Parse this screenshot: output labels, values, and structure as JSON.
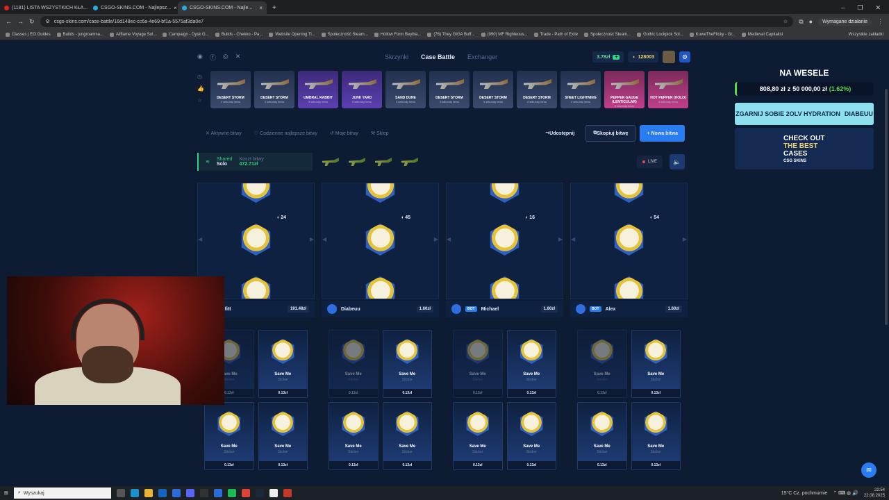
{
  "browser": {
    "tabs": [
      {
        "title": "(1181) LISTA WSZYSTKICH KŁA...",
        "color": "#e62117"
      },
      {
        "title": "CSGO-SKINS.COM - Najlepsz...",
        "color": "#27a9e1"
      },
      {
        "title": "CSGO-SKINS.COM - Najle...",
        "color": "#27a9e1"
      }
    ],
    "url": "csgo-skins.com/case-battle/16d148ec-cc6a-4e69-bf1a-5575af3da0e7",
    "action_label": "Wymagane działanie",
    "bookmarks": [
      "Classes | EO Guides",
      "Builds - jungroanma...",
      "Allflame Voyage Sol...",
      "Campaign - Dysk G...",
      "Builds - Chekko - Pa...",
      "Website Opening Ti...",
      "Społeczność Steam...",
      "Hollow Form Beybla...",
      "(76) They GIGA Buff...",
      "(990) MF Righteous...",
      "Trade - Path of Exile",
      "Społeczność Steam...",
      "Gothic Lockpick Sol...",
      "KuweTheFlicky - Gi...",
      "Medieval Capitalist"
    ],
    "bookmarks_all": "Wszystkie zakładki"
  },
  "nav": {
    "links": [
      "Skrzynki",
      "Case Battle",
      "Exchanger"
    ],
    "active": "Case Battle",
    "balance_money": "3.78zł",
    "balance_coins": "128003"
  },
  "drops": [
    {
      "name": "DESERT STORM",
      "sub": "2 sekundy temu",
      "style": ""
    },
    {
      "name": "DESERT STORM",
      "sub": "2 sekundy temu",
      "style": ""
    },
    {
      "name": "UMBRAL RABBIT",
      "sub": "3 sekundy temu",
      "style": "purple"
    },
    {
      "name": "JUNK YARD",
      "sub": "3 sekundy temu",
      "style": "purple"
    },
    {
      "name": "SAND DUNE",
      "sub": "3 sekundy temu",
      "style": ""
    },
    {
      "name": "DESERT STORM",
      "sub": "3 sekundy temu",
      "style": ""
    },
    {
      "name": "DESERT STORM",
      "sub": "3 sekundy temu",
      "style": ""
    },
    {
      "name": "DESERT STORM",
      "sub": "4 sekundy temu",
      "style": ""
    },
    {
      "name": "SHEET LIGHTNING",
      "sub": "4 sekundy temu",
      "style": ""
    },
    {
      "name": "PEPPER GAUGE (LENTICULAR)",
      "sub": "4 sekundy temu",
      "style": "pink"
    },
    {
      "name": "HOT PEPPER (HOLO)",
      "sub": "4 sekundy temu",
      "style": "pink"
    }
  ],
  "controls": {
    "active_battles": "Aktywne bitwy",
    "daily_best": "Codzienne najlepsze bitwy",
    "my_battles": "Moje bitwy",
    "shop": "Sklep",
    "share": "Udostępnij",
    "copy": "Skopiuj bitwę",
    "new": "+ Nowa bitwa"
  },
  "battle": {
    "mode_label": "Shared",
    "mode_value": "Solo",
    "cost_label": "Koszt bitwy",
    "cost_value": "472.71zł",
    "live": "LIVE"
  },
  "reels": [
    {
      "coins": "24"
    },
    {
      "coins": "45"
    },
    {
      "coins": "16"
    },
    {
      "coins": "54"
    }
  ],
  "players": [
    {
      "name": "via fitt",
      "price": "191.48zł",
      "bot": false
    },
    {
      "name": "Diabeuu",
      "price": "1.60zł",
      "bot": false
    },
    {
      "name": "Michael",
      "price": "1.60zł",
      "bot": true
    },
    {
      "name": "Alex",
      "price": "1.60zł",
      "bot": true
    }
  ],
  "item": {
    "name": "Save Me",
    "type": "Sticker",
    "price": "0.13zł"
  },
  "bot_label": "BOT",
  "promo": {
    "title": "NA WESELE",
    "amount": "808,80 zł",
    "of": "z",
    "goal": "50 000,00 zł",
    "percent": "(1.62%)",
    "ad1": "ZGARNIJ SOBIE 2OLV HYDRATION",
    "ad1_tag": "DIABEUU",
    "ad2_a": "CHECK OUT",
    "ad2_b": "THE BEST",
    "ad2_c": "CASES",
    "ad2_brand": "CSG SKINS"
  },
  "taskbar": {
    "search": "Wyszukaj",
    "weather": "15°C  Cz. pochmurnie",
    "time": "22:54",
    "date": "22.08.2025"
  }
}
